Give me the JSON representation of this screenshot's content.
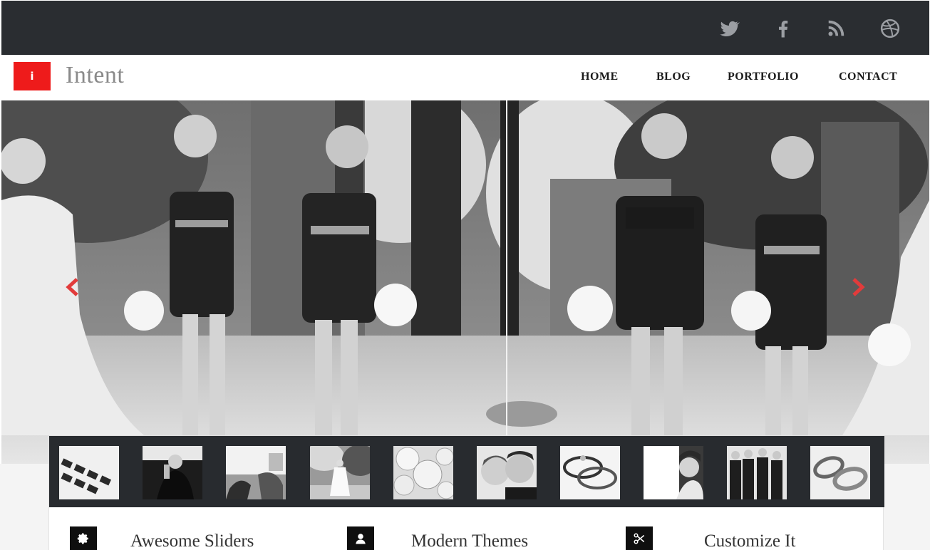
{
  "social": {
    "icons": [
      "twitter-icon",
      "facebook-icon",
      "rss-icon",
      "dribbble-icon"
    ],
    "color": "#9b9ea3"
  },
  "brand": {
    "logo_letter": "i",
    "name": "Intent",
    "accent": "#ee1b1b"
  },
  "nav": {
    "items": [
      {
        "label": "HOME"
      },
      {
        "label": "BLOG"
      },
      {
        "label": "PORTFOLIO"
      },
      {
        "label": "CONTACT"
      }
    ]
  },
  "slider": {
    "prev_icon": "chevron-left-icon",
    "next_icon": "chevron-right-icon",
    "arrow_color": "#e23b3b"
  },
  "thumbnails": [
    {
      "subject": "keyboard"
    },
    {
      "subject": "man-thinking"
    },
    {
      "subject": "clothes"
    },
    {
      "subject": "bride-walking"
    },
    {
      "subject": "roses"
    },
    {
      "subject": "couple"
    },
    {
      "subject": "rings"
    },
    {
      "subject": "bride-portrait"
    },
    {
      "subject": "groomsmen"
    },
    {
      "subject": "wedding-bands"
    }
  ],
  "features": [
    {
      "icon": "gear-icon",
      "title": "Awesome Sliders"
    },
    {
      "icon": "user-icon",
      "title": "Modern Themes"
    },
    {
      "icon": "scissors-icon",
      "title": "Customize It"
    }
  ]
}
